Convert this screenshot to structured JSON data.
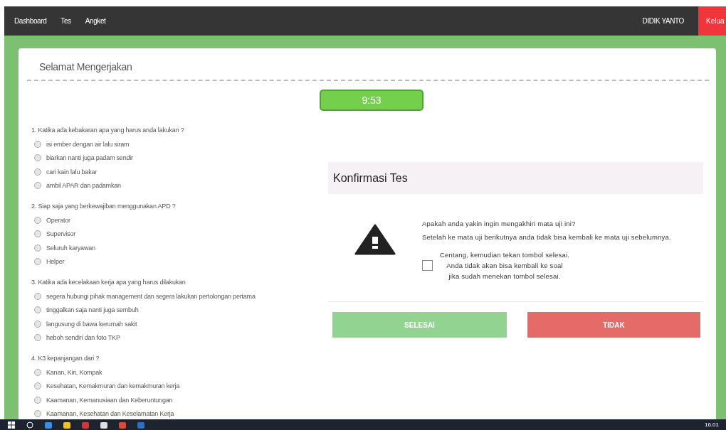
{
  "navbar": {
    "items": [
      {
        "label": "Dashboard"
      },
      {
        "label": "Tes"
      },
      {
        "label": "Angket"
      }
    ],
    "user": "DIDIK YANTO",
    "logout": "Kelua"
  },
  "page": {
    "title": "Selamat Mengerjakan",
    "timer": "9:53"
  },
  "questions": [
    {
      "text": "1. Katika ada kebakaran apa yang harus anda lakukan ?",
      "options": [
        {
          "label": "isi ember dengan air lalu siram",
          "selected": false
        },
        {
          "label": "biarkan nanti juga padam sendir",
          "selected": false
        },
        {
          "label": "cari kain lalu bakar",
          "selected": false
        },
        {
          "label": "ambil APAR dan padamkan",
          "selected": false
        }
      ]
    },
    {
      "text": "2. Siap saja yang berkewajiban menggunakan APD ?",
      "options": [
        {
          "label": "Operator",
          "selected": false
        },
        {
          "label": "Supervisor",
          "selected": false
        },
        {
          "label": "Seluruh karyawan",
          "selected": false
        },
        {
          "label": "Helper",
          "selected": false
        }
      ]
    },
    {
      "text": "3. Katika ada kecelakaan kerja apa yang harus dilakukan",
      "options": [
        {
          "label": "segera hubungi pihak management dan segera lakukan pertolongan pertama",
          "selected": false
        },
        {
          "label": "tinggalkan saja nanti juga sembuh",
          "selected": false
        },
        {
          "label": "langusung di bawa kerumah sakit",
          "selected": false
        },
        {
          "label": "heboh sendiri dan foto TKP",
          "selected": false
        }
      ]
    },
    {
      "text": "4. K3 kepanjangan dari ?",
      "options": [
        {
          "label": "Kanan, Kiri, Kompak",
          "selected": false
        },
        {
          "label": "Kesehatan, Kemakmuran dan kemakmuran kerja",
          "selected": false
        },
        {
          "label": "Kaamanan, Kemanusiaan dan Keberuntungan",
          "selected": false
        },
        {
          "label": "Kaamanan, Kesehatan dan Keselamatan Kerja",
          "selected": false
        }
      ]
    }
  ],
  "dialog": {
    "title": "Konfirmasi Tes",
    "message": "Apakah anda yakin ingin mengakhiri mata uji ini?",
    "detail": "Setelah ke mata uji berikutnya anda tidak bisa kembali ke mata uji sebelumnya.",
    "confirm": {
      "checked": false,
      "lines": [
        "Centang, kemudian tekan tombol selesai.",
        "Anda tidak akan bisa kembali ke soal",
        "jika sudah menekan tombol selesai."
      ]
    },
    "buttons": [
      {
        "label": "SELESAI",
        "kind": "ok"
      },
      {
        "label": "TIDAK",
        "kind": "cancel"
      }
    ]
  },
  "taskbar": {
    "clock": "16.01"
  }
}
